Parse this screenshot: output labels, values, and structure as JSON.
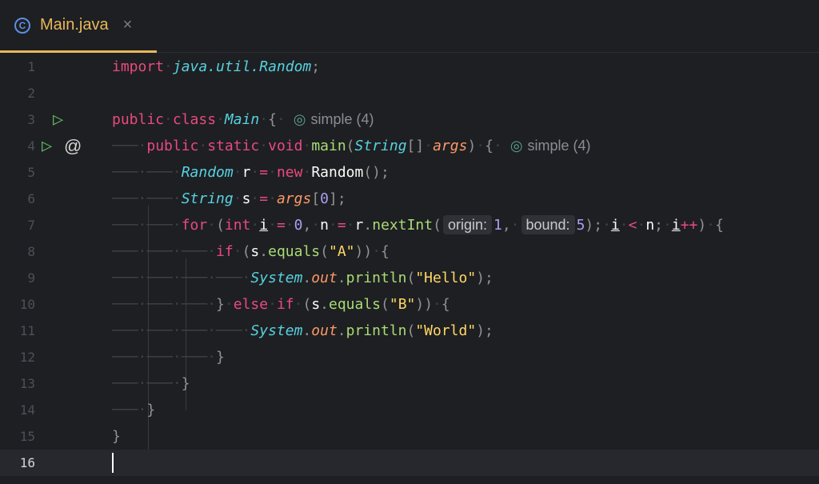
{
  "tab": {
    "label": "Main.java",
    "icon": "C",
    "close": "×"
  },
  "lens": {
    "icon": "@",
    "label": "simple (4)"
  },
  "lines": {
    "l1": "1",
    "l2": "2",
    "l3": "3",
    "l4": "4",
    "l5": "5",
    "l6": "6",
    "l7": "7",
    "l8": "8",
    "l9": "9",
    "l10": "10",
    "l11": "11",
    "l12": "12",
    "l13": "13",
    "l14": "14",
    "l15": "15",
    "l16": "16"
  },
  "hints": {
    "origin": "origin:",
    "bound": "bound:"
  },
  "code": {
    "import_kw": "import",
    "import_pkg": "java.util.Random",
    "public": "public",
    "class": "class",
    "Main": "Main",
    "static": "static",
    "void": "void",
    "main": "main",
    "String": "String",
    "args": "args",
    "Random": "Random",
    "r": "r",
    "new": "new",
    "s": "s",
    "zero": "0",
    "for": "for",
    "int": "int",
    "i": "i",
    "n": "n",
    "nextInt": "nextInt",
    "one": "1",
    "five": "5",
    "if": "if",
    "equals": "equals",
    "strA": "\"A\"",
    "System": "System",
    "out": "out",
    "println": "println",
    "strHello": "\"Hello\"",
    "else": "else",
    "strB": "\"B\"",
    "strWorld": "\"World\""
  },
  "colors": {
    "background": "#1e1f22",
    "tab_accent": "#e7b85a",
    "keyword": "#e84a7f",
    "class": "#56d2e0",
    "string": "#ffd866",
    "number": "#ab9df2",
    "run_icon": "#5fb865"
  },
  "icons": {
    "tab": "java-class-icon",
    "close": "close-icon",
    "run": "run-icon",
    "implements": "override-at-icon",
    "lens": "swirl-icon"
  }
}
